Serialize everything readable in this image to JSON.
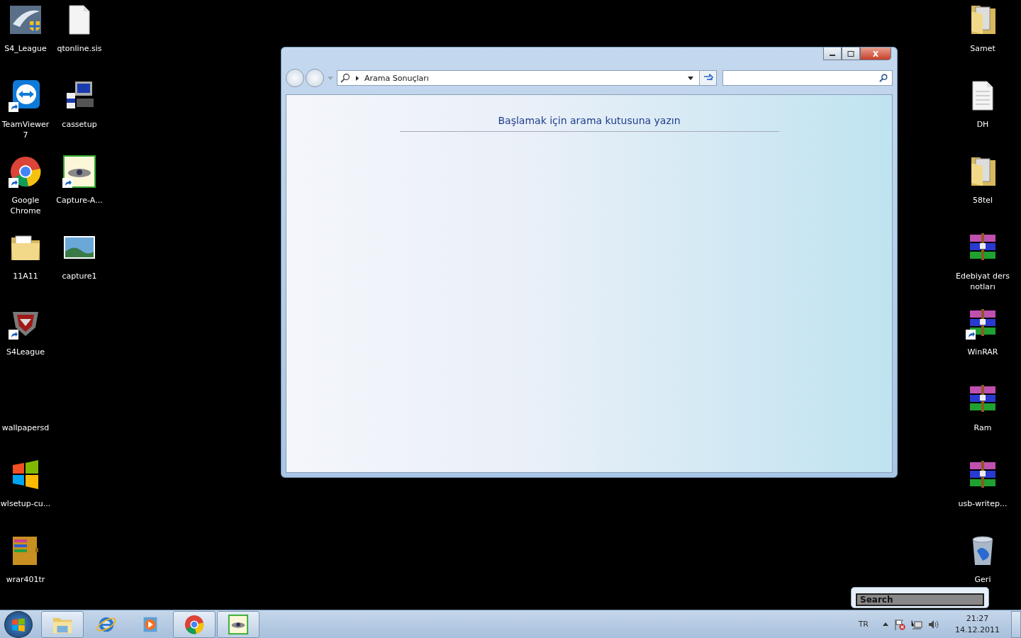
{
  "desktop_left": [
    {
      "label": "S4_League",
      "kind": "shield",
      "shortcut": false
    },
    {
      "label": "TeamViewer 7",
      "kind": "teamviewer",
      "shortcut": true
    },
    {
      "label": "Google Chrome",
      "kind": "chrome",
      "shortcut": true
    },
    {
      "label": "11A11",
      "kind": "folder",
      "shortcut": false
    },
    {
      "label": "S4League",
      "kind": "game",
      "shortcut": true
    },
    {
      "label": "wallpapersd",
      "kind": "none"
    },
    {
      "label": "wlsetup-cu...",
      "kind": "windows",
      "shortcut": false
    },
    {
      "label": "wrar401tr",
      "kind": "archive",
      "shortcut": false
    },
    {
      "label": "qtonline.sis",
      "kind": "blankfile",
      "shortcut": false
    },
    {
      "label": "cassetup",
      "kind": "installer",
      "shortcut": false
    },
    {
      "label": "Capture-A...",
      "kind": "capture",
      "shortcut": true
    },
    {
      "label": "capture1",
      "kind": "picture",
      "shortcut": false
    }
  ],
  "desktop_right": [
    {
      "label": "Samet",
      "kind": "folder",
      "shortcut": false
    },
    {
      "label": "DH",
      "kind": "file",
      "shortcut": false
    },
    {
      "label": "58tel",
      "kind": "folder",
      "shortcut": false
    },
    {
      "label": "Edebiyat ders notları",
      "kind": "rar",
      "shortcut": false
    },
    {
      "label": "WinRAR",
      "kind": "rar",
      "shortcut": true
    },
    {
      "label": "Ram",
      "kind": "rar",
      "shortcut": false
    },
    {
      "label": "usb-writep...",
      "kind": "rar",
      "shortcut": false
    },
    {
      "label": "Geri",
      "kind": "trash",
      "shortcut": false
    }
  ],
  "window": {
    "breadcrumb": "Arama Sonuçları",
    "message": "Başlamak için arama kutusuna yazın"
  },
  "search_popup": {
    "value": "Search"
  },
  "taskbar": {
    "items": [
      {
        "kind": "explorer",
        "open": true
      },
      {
        "kind": "ie",
        "open": false
      },
      {
        "kind": "media",
        "open": false
      },
      {
        "kind": "chrome",
        "open": true
      },
      {
        "kind": "capture",
        "open": true
      }
    ],
    "language": "TR",
    "time": "21:27",
    "date": "14.12.2011"
  }
}
